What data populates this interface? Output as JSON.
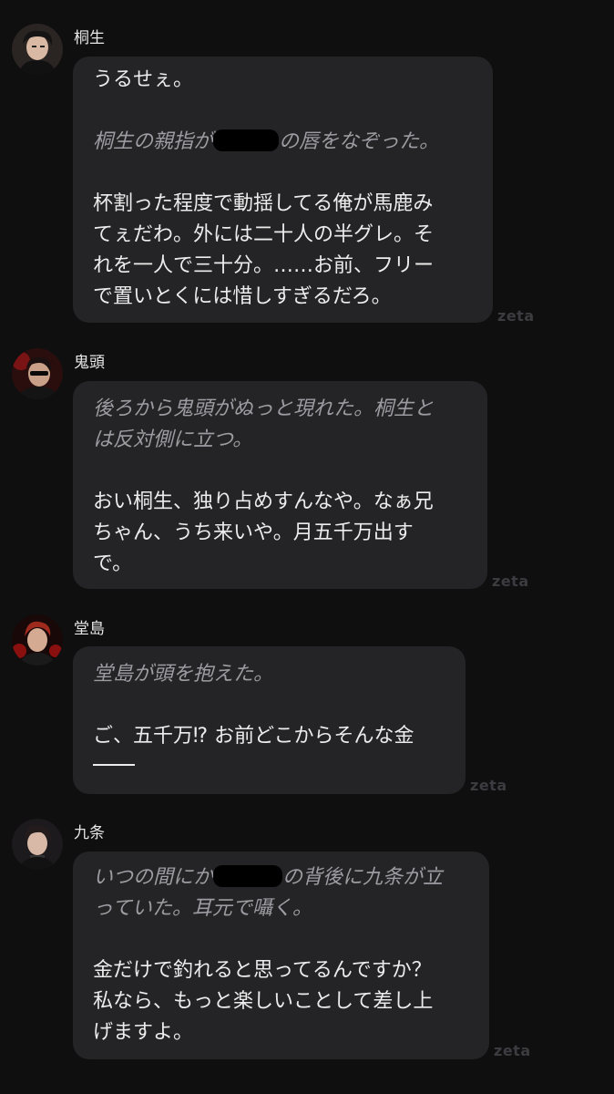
{
  "messages": [
    {
      "author": "桐生",
      "avatar_icon": "character-avatar-kiryu",
      "lines": [
        {
          "text": "うるせぇ。",
          "kind": "speech"
        },
        {
          "kind": "gap"
        },
        {
          "before": "桐生の親指が",
          "after": "の唇をなぞった。",
          "kind": "narration-redacted"
        },
        {
          "kind": "gap"
        },
        {
          "text": "杯割った程度で動揺してる俺が馬鹿み",
          "kind": "speech"
        },
        {
          "text": "てぇだわ。外には二十人の半グレ。そ",
          "kind": "speech"
        },
        {
          "text": "れを一人で三十分。……お前、フリー",
          "kind": "speech"
        },
        {
          "text": "で置いとくには惜しすぎるだろ。",
          "kind": "speech"
        }
      ],
      "watermark": "zeta"
    },
    {
      "author": "鬼頭",
      "avatar_icon": "character-avatar-kito",
      "lines": [
        {
          "text": "後ろから鬼頭がぬっと現れた。桐生と",
          "kind": "narration"
        },
        {
          "text": "は反対側に立つ。",
          "kind": "narration"
        },
        {
          "kind": "gap"
        },
        {
          "text": "おい桐生、独り占めすんなや。なぁ兄",
          "kind": "speech"
        },
        {
          "text": "ちゃん、うち来いや。月五千万出す",
          "kind": "speech"
        },
        {
          "text": "で。",
          "kind": "speech"
        }
      ],
      "watermark": "zeta"
    },
    {
      "author": "堂島",
      "avatar_icon": "character-avatar-dojima",
      "lines": [
        {
          "text": "堂島が頭を抱えた。",
          "kind": "narration"
        },
        {
          "kind": "gap"
        },
        {
          "text": "ご、五千万⁉ お前どこからそんな金",
          "kind": "speech"
        },
        {
          "kind": "dash"
        }
      ],
      "watermark": "zeta"
    },
    {
      "author": "九条",
      "avatar_icon": "character-avatar-kujo",
      "lines": [
        {
          "before": "いつの間にか",
          "after": "の背後に九条が立",
          "kind": "narration-redacted"
        },
        {
          "text": "っていた。耳元で囁く。",
          "kind": "narration"
        },
        {
          "kind": "gap"
        },
        {
          "text": "金だけで釣れると思ってるんですか？",
          "kind": "speech"
        },
        {
          "text": "私なら、もっと楽しいことして差し上",
          "kind": "speech"
        },
        {
          "text": "げますよ。",
          "kind": "speech"
        }
      ],
      "watermark": "zeta"
    }
  ]
}
